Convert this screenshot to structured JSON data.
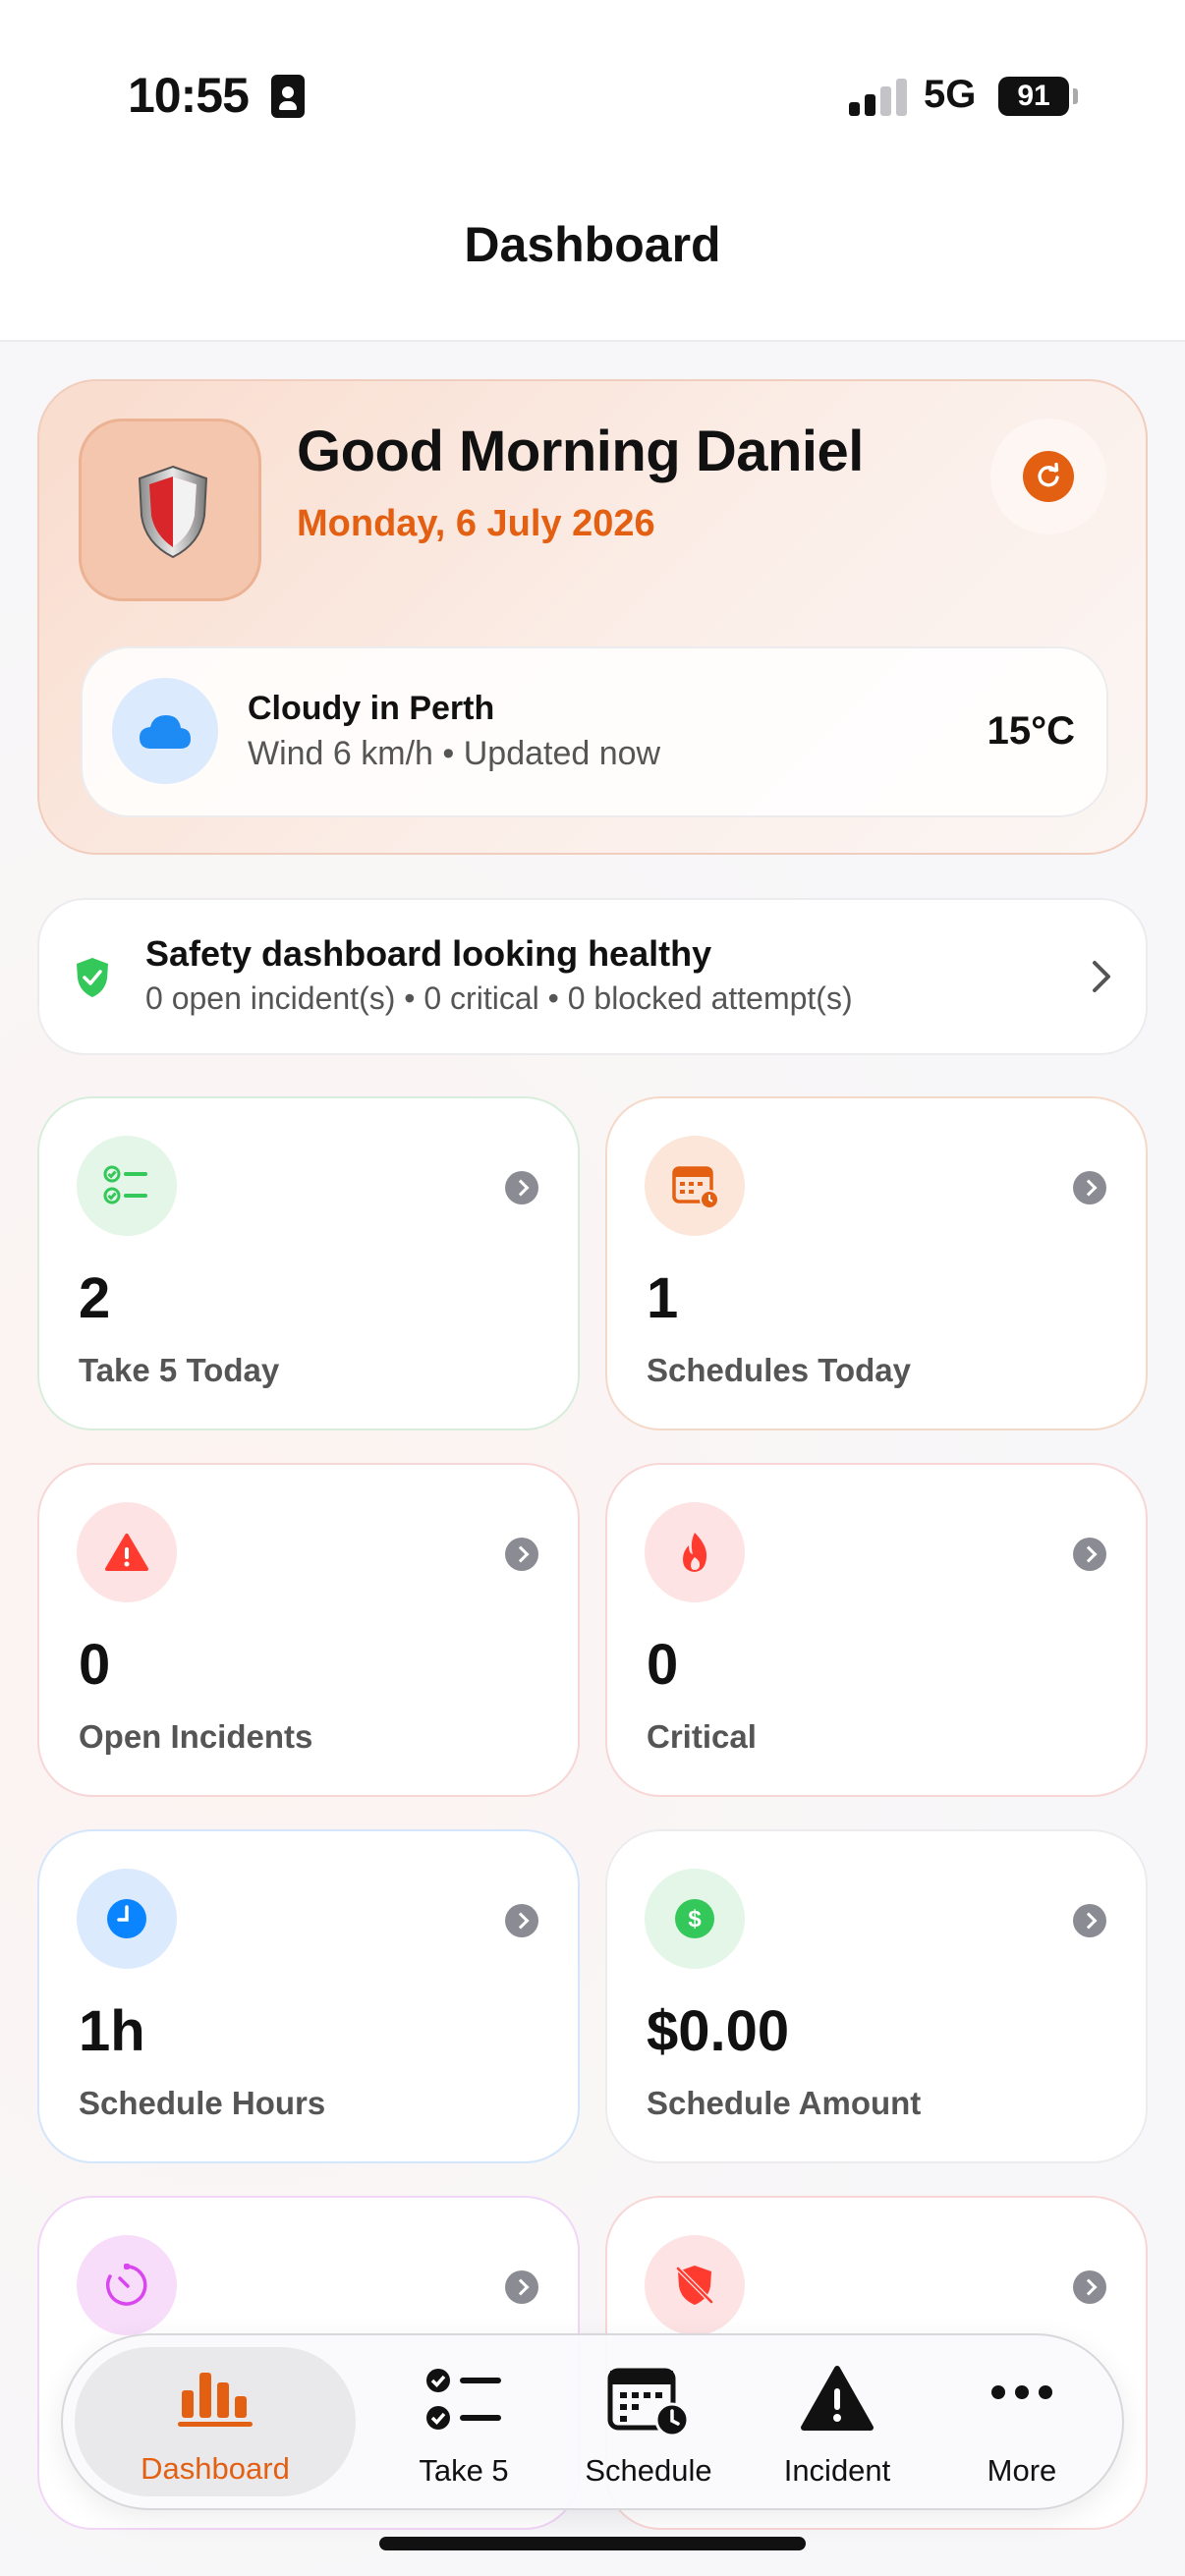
{
  "status_bar": {
    "time": "10:55",
    "network": "5G",
    "battery": "91"
  },
  "header": {
    "title": "Dashboard"
  },
  "greeting_card": {
    "greeting": "Good Morning Daniel",
    "date": "Monday, 6 July 2026",
    "icon": "shield-logo",
    "refresh_icon": "refresh-icon"
  },
  "weather": {
    "title": "Cloudy in Perth",
    "subtitle": "Wind 6 km/h • Updated now",
    "temperature": "15°C",
    "icon": "cloud-icon"
  },
  "health": {
    "title": "Safety dashboard looking healthy",
    "subtitle": "0 open incident(s) • 0 critical • 0 blocked attempt(s)"
  },
  "tiles": [
    {
      "value": "2",
      "label": "Take 5 Today",
      "icon": "checklist-icon",
      "color": "#34c759"
    },
    {
      "value": "1",
      "label": "Schedules Today",
      "icon": "calendar-icon",
      "color": "#e35f12"
    },
    {
      "value": "0",
      "label": "Open Incidents",
      "icon": "warning-icon",
      "color": "#ff3b30"
    },
    {
      "value": "0",
      "label": "Critical",
      "icon": "flame-icon",
      "color": "#ff3b30"
    },
    {
      "value": "1h",
      "label": "Schedule Hours",
      "icon": "clock-icon",
      "color": "#0a84ff"
    },
    {
      "value": "$0.00",
      "label": "Schedule Amount",
      "icon": "dollar-icon",
      "color": "#34c759"
    },
    {
      "value": "",
      "label": "",
      "icon": "timer-icon",
      "color": "#d946ef"
    },
    {
      "value": "",
      "label": "",
      "icon": "blocked-shield-icon",
      "color": "#ff3b30"
    }
  ],
  "tab_bar": {
    "tabs": [
      {
        "label": "Dashboard",
        "icon": "bar-chart-icon",
        "active": true
      },
      {
        "label": "Take 5",
        "icon": "checklist-icon",
        "active": false
      },
      {
        "label": "Schedule",
        "icon": "calendar-clock-icon",
        "active": false
      },
      {
        "label": "Incident",
        "icon": "warning-icon",
        "active": false
      },
      {
        "label": "More",
        "icon": "more-icon",
        "active": false
      }
    ]
  }
}
